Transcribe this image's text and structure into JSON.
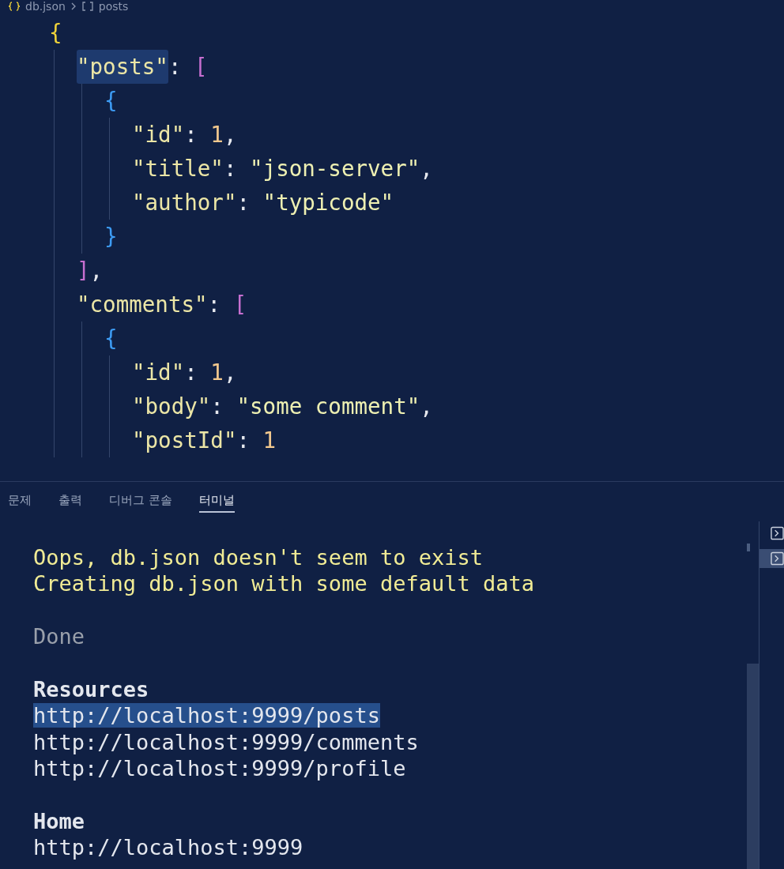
{
  "breadcrumb": {
    "file": "db.json",
    "symbol": "posts"
  },
  "editor": {
    "lines": [
      {
        "tokens": [
          {
            "kind": "brace1",
            "text": "{"
          }
        ],
        "children": [
          {
            "tokens": [
              {
                "kind": "key",
                "text": "\"posts\"",
                "highlighted": true
              },
              {
                "kind": "punct",
                "text": ": "
              },
              {
                "kind": "brace2",
                "text": "["
              }
            ],
            "children": [
              {
                "tokens": [
                  {
                    "kind": "brace3",
                    "text": "{"
                  }
                ],
                "children": [
                  {
                    "tokens": [
                      {
                        "kind": "key",
                        "text": "\"id\""
                      },
                      {
                        "kind": "punct",
                        "text": ": "
                      },
                      {
                        "kind": "number",
                        "text": "1"
                      },
                      {
                        "kind": "punct",
                        "text": ","
                      }
                    ]
                  },
                  {
                    "tokens": [
                      {
                        "kind": "key",
                        "text": "\"title\""
                      },
                      {
                        "kind": "punct",
                        "text": ": "
                      },
                      {
                        "kind": "string",
                        "text": "\"json-server\""
                      },
                      {
                        "kind": "punct",
                        "text": ","
                      }
                    ]
                  },
                  {
                    "tokens": [
                      {
                        "kind": "key",
                        "text": "\"author\""
                      },
                      {
                        "kind": "punct",
                        "text": ": "
                      },
                      {
                        "kind": "string",
                        "text": "\"typicode\""
                      }
                    ]
                  }
                ]
              },
              {
                "tokens": [
                  {
                    "kind": "brace3",
                    "text": "}"
                  }
                ]
              }
            ]
          },
          {
            "tokens": [
              {
                "kind": "brace2",
                "text": "]"
              },
              {
                "kind": "punct",
                "text": ","
              }
            ]
          },
          {
            "tokens": [
              {
                "kind": "key",
                "text": "\"comments\""
              },
              {
                "kind": "punct",
                "text": ": "
              },
              {
                "kind": "brace2",
                "text": "["
              }
            ],
            "children": [
              {
                "tokens": [
                  {
                    "kind": "brace3",
                    "text": "{"
                  }
                ],
                "children": [
                  {
                    "tokens": [
                      {
                        "kind": "key",
                        "text": "\"id\""
                      },
                      {
                        "kind": "punct",
                        "text": ": "
                      },
                      {
                        "kind": "number",
                        "text": "1"
                      },
                      {
                        "kind": "punct",
                        "text": ","
                      }
                    ]
                  },
                  {
                    "tokens": [
                      {
                        "kind": "key",
                        "text": "\"body\""
                      },
                      {
                        "kind": "punct",
                        "text": ": "
                      },
                      {
                        "kind": "string",
                        "text": "\"some comment\""
                      },
                      {
                        "kind": "punct",
                        "text": ","
                      }
                    ]
                  },
                  {
                    "tokens": [
                      {
                        "kind": "key",
                        "text": "\"postId\""
                      },
                      {
                        "kind": "punct",
                        "text": ": "
                      },
                      {
                        "kind": "number",
                        "text": "1"
                      }
                    ]
                  }
                ]
              }
            ]
          }
        ]
      }
    ]
  },
  "panel": {
    "tabs": [
      {
        "label": "문제",
        "selected": false
      },
      {
        "label": "출력",
        "selected": false
      },
      {
        "label": "디버그 콘솔",
        "selected": false
      },
      {
        "label": "터미널",
        "selected": true
      }
    ],
    "terminal": {
      "lines": [
        {
          "kind": "warning",
          "text": "Oops, db.json doesn't seem to exist"
        },
        {
          "kind": "warning",
          "text": "Creating db.json with some default data"
        },
        {
          "kind": "blank"
        },
        {
          "kind": "muted",
          "text": "Done"
        },
        {
          "kind": "blank"
        },
        {
          "kind": "heading",
          "text": "Resources"
        },
        {
          "kind": "link",
          "text": "http://localhost:9999/posts",
          "selected": true
        },
        {
          "kind": "link",
          "text": "http://localhost:9999/comments",
          "selected": false
        },
        {
          "kind": "link",
          "text": "http://localhost:9999/profile",
          "selected": false
        },
        {
          "kind": "blank"
        },
        {
          "kind": "heading",
          "text": "Home"
        },
        {
          "kind": "link",
          "text": "http://localhost:9999",
          "selected": false
        }
      ]
    },
    "instances": [
      {
        "selected": false
      },
      {
        "selected": true
      }
    ]
  }
}
